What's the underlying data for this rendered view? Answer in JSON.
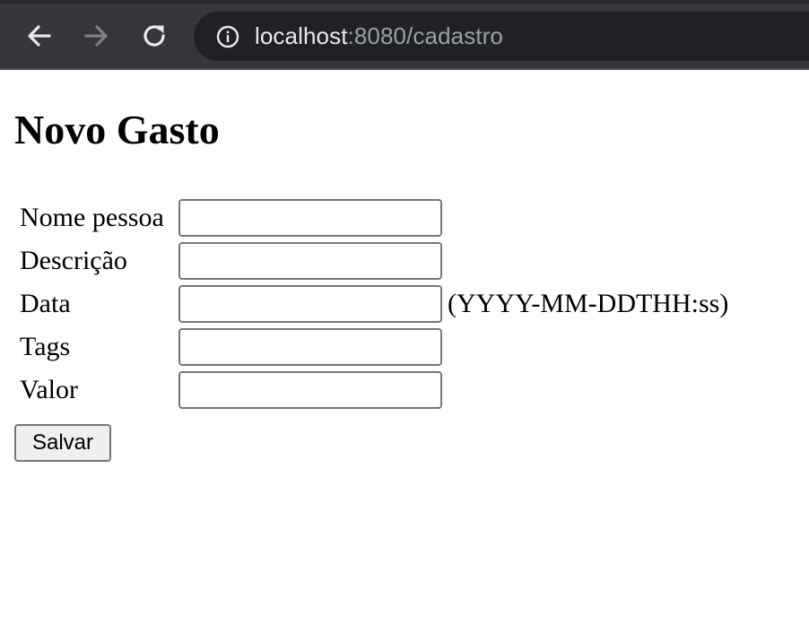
{
  "browser": {
    "url_host": "localhost",
    "url_rest": ":8080/cadastro",
    "icons": {
      "back": "arrow-left",
      "forward": "arrow-right",
      "reload": "reload",
      "site_info": "info-circle"
    },
    "colors": {
      "toolbar": "#35363a",
      "omnibox": "#202124",
      "url_host": "#e8eaed",
      "url_rest": "#9aa0a6"
    }
  },
  "page": {
    "title": "Novo Gasto",
    "form": {
      "fields": [
        {
          "label": "Nome pessoa",
          "value": "",
          "hint": ""
        },
        {
          "label": "Descrição",
          "value": "",
          "hint": ""
        },
        {
          "label": "Data",
          "value": "",
          "hint": "(YYYY-MM-DDTHH:ss)"
        },
        {
          "label": "Tags",
          "value": "",
          "hint": ""
        },
        {
          "label": "Valor",
          "value": "",
          "hint": ""
        }
      ],
      "submit_label": "Salvar"
    }
  }
}
